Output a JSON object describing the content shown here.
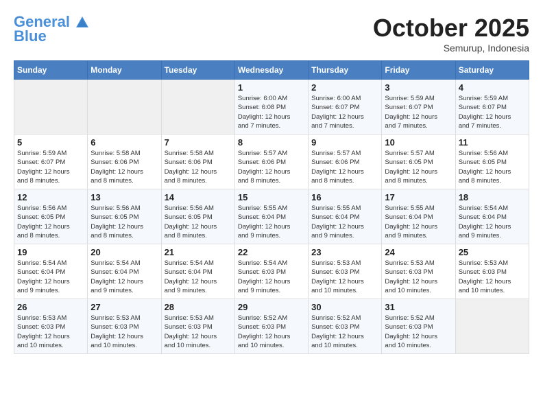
{
  "header": {
    "logo_line1": "General",
    "logo_line2": "Blue",
    "month": "October 2025",
    "location": "Semurup, Indonesia"
  },
  "weekdays": [
    "Sunday",
    "Monday",
    "Tuesday",
    "Wednesday",
    "Thursday",
    "Friday",
    "Saturday"
  ],
  "weeks": [
    [
      {
        "day": "",
        "info": ""
      },
      {
        "day": "",
        "info": ""
      },
      {
        "day": "",
        "info": ""
      },
      {
        "day": "1",
        "info": "Sunrise: 6:00 AM\nSunset: 6:08 PM\nDaylight: 12 hours\nand 7 minutes."
      },
      {
        "day": "2",
        "info": "Sunrise: 6:00 AM\nSunset: 6:07 PM\nDaylight: 12 hours\nand 7 minutes."
      },
      {
        "day": "3",
        "info": "Sunrise: 5:59 AM\nSunset: 6:07 PM\nDaylight: 12 hours\nand 7 minutes."
      },
      {
        "day": "4",
        "info": "Sunrise: 5:59 AM\nSunset: 6:07 PM\nDaylight: 12 hours\nand 7 minutes."
      }
    ],
    [
      {
        "day": "5",
        "info": "Sunrise: 5:59 AM\nSunset: 6:07 PM\nDaylight: 12 hours\nand 8 minutes."
      },
      {
        "day": "6",
        "info": "Sunrise: 5:58 AM\nSunset: 6:06 PM\nDaylight: 12 hours\nand 8 minutes."
      },
      {
        "day": "7",
        "info": "Sunrise: 5:58 AM\nSunset: 6:06 PM\nDaylight: 12 hours\nand 8 minutes."
      },
      {
        "day": "8",
        "info": "Sunrise: 5:57 AM\nSunset: 6:06 PM\nDaylight: 12 hours\nand 8 minutes."
      },
      {
        "day": "9",
        "info": "Sunrise: 5:57 AM\nSunset: 6:06 PM\nDaylight: 12 hours\nand 8 minutes."
      },
      {
        "day": "10",
        "info": "Sunrise: 5:57 AM\nSunset: 6:05 PM\nDaylight: 12 hours\nand 8 minutes."
      },
      {
        "day": "11",
        "info": "Sunrise: 5:56 AM\nSunset: 6:05 PM\nDaylight: 12 hours\nand 8 minutes."
      }
    ],
    [
      {
        "day": "12",
        "info": "Sunrise: 5:56 AM\nSunset: 6:05 PM\nDaylight: 12 hours\nand 8 minutes."
      },
      {
        "day": "13",
        "info": "Sunrise: 5:56 AM\nSunset: 6:05 PM\nDaylight: 12 hours\nand 8 minutes."
      },
      {
        "day": "14",
        "info": "Sunrise: 5:56 AM\nSunset: 6:05 PM\nDaylight: 12 hours\nand 8 minutes."
      },
      {
        "day": "15",
        "info": "Sunrise: 5:55 AM\nSunset: 6:04 PM\nDaylight: 12 hours\nand 9 minutes."
      },
      {
        "day": "16",
        "info": "Sunrise: 5:55 AM\nSunset: 6:04 PM\nDaylight: 12 hours\nand 9 minutes."
      },
      {
        "day": "17",
        "info": "Sunrise: 5:55 AM\nSunset: 6:04 PM\nDaylight: 12 hours\nand 9 minutes."
      },
      {
        "day": "18",
        "info": "Sunrise: 5:54 AM\nSunset: 6:04 PM\nDaylight: 12 hours\nand 9 minutes."
      }
    ],
    [
      {
        "day": "19",
        "info": "Sunrise: 5:54 AM\nSunset: 6:04 PM\nDaylight: 12 hours\nand 9 minutes."
      },
      {
        "day": "20",
        "info": "Sunrise: 5:54 AM\nSunset: 6:04 PM\nDaylight: 12 hours\nand 9 minutes."
      },
      {
        "day": "21",
        "info": "Sunrise: 5:54 AM\nSunset: 6:04 PM\nDaylight: 12 hours\nand 9 minutes."
      },
      {
        "day": "22",
        "info": "Sunrise: 5:54 AM\nSunset: 6:03 PM\nDaylight: 12 hours\nand 9 minutes."
      },
      {
        "day": "23",
        "info": "Sunrise: 5:53 AM\nSunset: 6:03 PM\nDaylight: 12 hours\nand 10 minutes."
      },
      {
        "day": "24",
        "info": "Sunrise: 5:53 AM\nSunset: 6:03 PM\nDaylight: 12 hours\nand 10 minutes."
      },
      {
        "day": "25",
        "info": "Sunrise: 5:53 AM\nSunset: 6:03 PM\nDaylight: 12 hours\nand 10 minutes."
      }
    ],
    [
      {
        "day": "26",
        "info": "Sunrise: 5:53 AM\nSunset: 6:03 PM\nDaylight: 12 hours\nand 10 minutes."
      },
      {
        "day": "27",
        "info": "Sunrise: 5:53 AM\nSunset: 6:03 PM\nDaylight: 12 hours\nand 10 minutes."
      },
      {
        "day": "28",
        "info": "Sunrise: 5:53 AM\nSunset: 6:03 PM\nDaylight: 12 hours\nand 10 minutes."
      },
      {
        "day": "29",
        "info": "Sunrise: 5:52 AM\nSunset: 6:03 PM\nDaylight: 12 hours\nand 10 minutes."
      },
      {
        "day": "30",
        "info": "Sunrise: 5:52 AM\nSunset: 6:03 PM\nDaylight: 12 hours\nand 10 minutes."
      },
      {
        "day": "31",
        "info": "Sunrise: 5:52 AM\nSunset: 6:03 PM\nDaylight: 12 hours\nand 10 minutes."
      },
      {
        "day": "",
        "info": ""
      }
    ]
  ]
}
